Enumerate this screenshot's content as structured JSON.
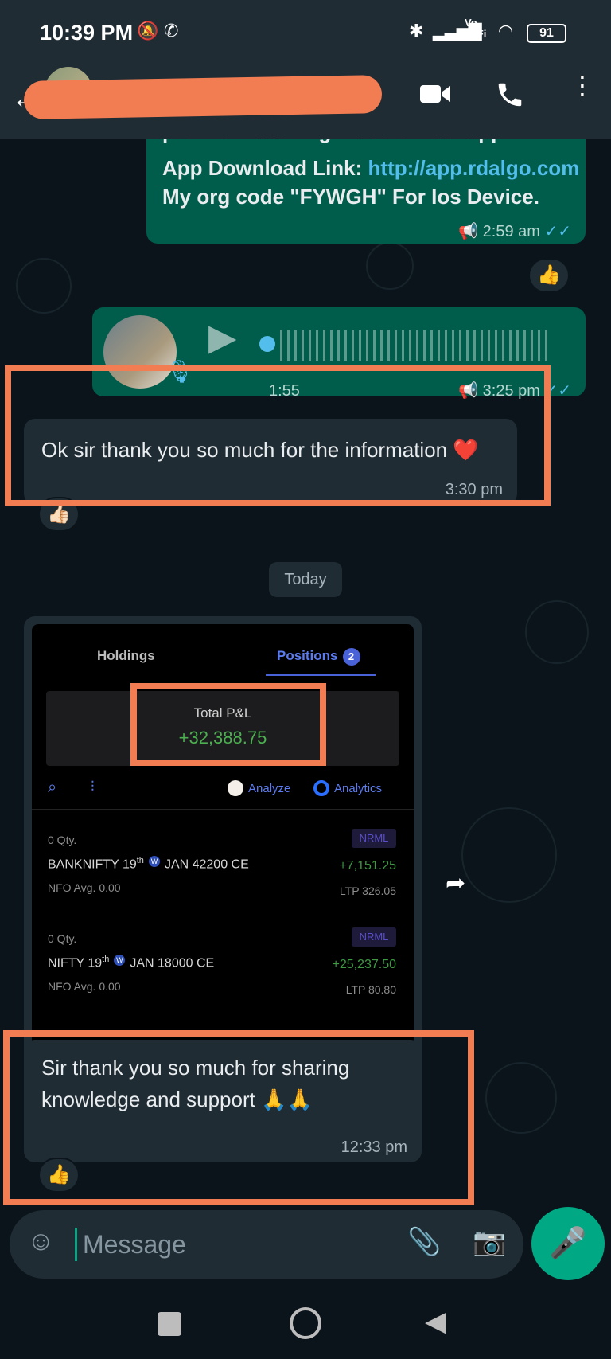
{
  "status_bar": {
    "time": "10:39 PM",
    "network_label": "Vo WiFi",
    "battery": "91"
  },
  "header": {
    "icons": [
      "back-arrow-icon",
      "video-call-icon",
      "voice-call-icon",
      "more-options-icon"
    ]
  },
  "messages": {
    "m1": {
      "partial": "premium training video on our app.",
      "download_label": "App Download Link:",
      "link": "http://app.rdalgo.com",
      "org_line": "My org code \"FYWGH\" For Ios Device.",
      "time": "2:59 am",
      "reaction": "👍"
    },
    "voice": {
      "duration": "1:55",
      "time": "3:25 pm"
    },
    "m2": {
      "text": "Ok sir thank you so much for the information ❤️",
      "time": "3:30 pm",
      "reaction": "👍🏻"
    },
    "date_chip": "Today",
    "shared_image": {
      "tab_holdings": "Holdings",
      "tab_positions": "Positions",
      "positions_count": "2",
      "pnl_label": "Total P&L",
      "pnl_value": "+32,388.75",
      "analyze": "Analyze",
      "analytics": "Analytics",
      "rows": [
        {
          "qty": "0 Qty.",
          "name": "BANKNIFTY 19",
          "sup": "th",
          "rest": "JAN 42200 CE",
          "sub": "NFO  Avg. 0.00",
          "tag": "NRML",
          "pnl": "+7,151.25",
          "ltp": "LTP 326.05"
        },
        {
          "qty": "0 Qty.",
          "name": "NIFTY 19",
          "sup": "th",
          "rest": "JAN 18000 CE",
          "sub": "NFO  Avg. 0.00",
          "tag": "NRML",
          "pnl": "+25,237.50",
          "ltp": "LTP 80.80"
        }
      ]
    },
    "m3": {
      "line1": "Sir thank you so much for sharing",
      "line2": "knowledge and support 🙏🙏",
      "time": "12:33 pm",
      "reaction": "👍"
    }
  },
  "composer": {
    "placeholder": "Message"
  },
  "colors": {
    "accent": "#00a884",
    "highlight": "#f27d52",
    "link": "#53bdeb",
    "pnl_green": "#4cb050"
  }
}
